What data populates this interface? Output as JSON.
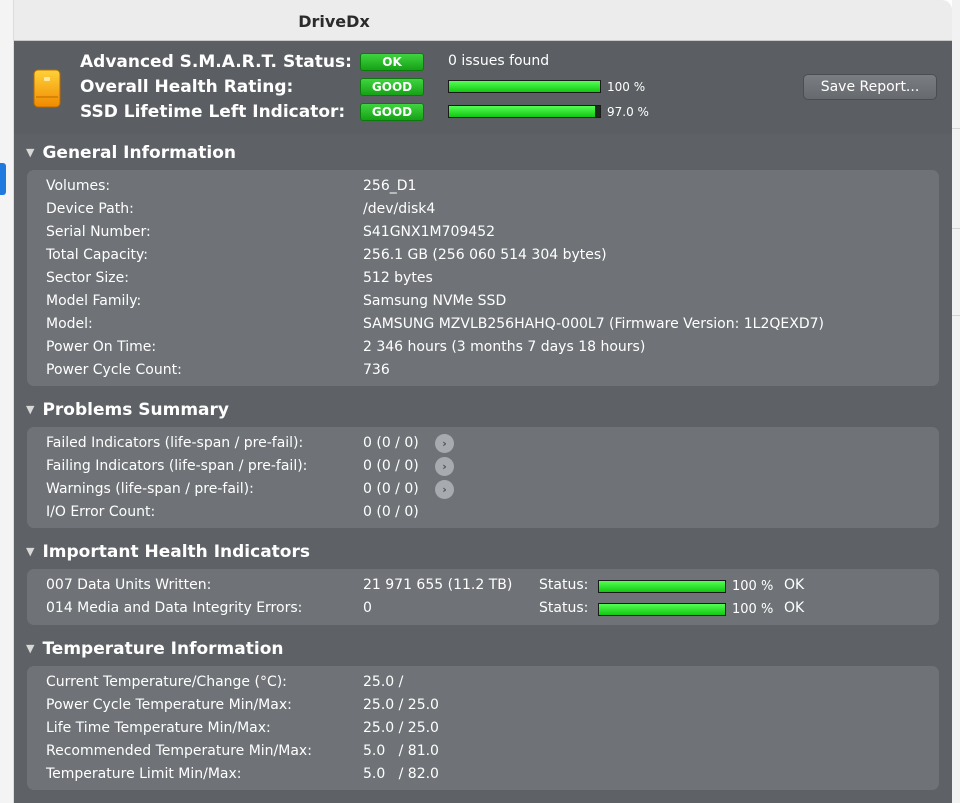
{
  "window": {
    "title": "DriveDx"
  },
  "top": {
    "smart_label": "Advanced S.M.A.R.T. Status:",
    "smart_badge": "OK",
    "smart_issues": "0 issues found",
    "health_label": "Overall Health Rating:",
    "health_badge": "GOOD",
    "health_percent_text": "100 %",
    "health_fraction": 1.0,
    "ssd_label": "SSD Lifetime Left Indicator:",
    "ssd_badge": "GOOD",
    "ssd_percent_text": "97.0 %",
    "ssd_fraction": 0.97,
    "save_button": "Save Report...",
    "badge_color": "#1fb31f",
    "bar_color": "#22dd22"
  },
  "general": {
    "heading": "General Information",
    "rows": [
      {
        "key": "Volumes:",
        "value": "256_D1"
      },
      {
        "key": "Device Path:",
        "value": "/dev/disk4"
      },
      {
        "key": "Serial Number:",
        "value": "S41GNX1M709452"
      },
      {
        "key": "Total Capacity:",
        "value": "256.1 GB (256 060 514 304 bytes)"
      },
      {
        "key": "Sector Size:",
        "value": "512 bytes"
      },
      {
        "key": "Model Family:",
        "value": "Samsung NVMe SSD"
      },
      {
        "key": "Model:",
        "value": "SAMSUNG MZVLB256HAHQ-000L7  (Firmware Version: 1L2QEXD7)"
      },
      {
        "key": "Power On Time:",
        "value": "2 346 hours (3 months 7 days 18 hours)"
      },
      {
        "key": "Power Cycle Count:",
        "value": "736"
      }
    ]
  },
  "problems": {
    "heading": "Problems Summary",
    "rows": [
      {
        "key": "Failed Indicators (life-span / pre-fail):",
        "value": "0 (0 / 0)"
      },
      {
        "key": "Failing Indicators (life-span / pre-fail):",
        "value": "0 (0 / 0)"
      },
      {
        "key": "Warnings (life-span / pre-fail):",
        "value": "0 (0 / 0)"
      },
      {
        "key": "I/O Error Count:",
        "value": "0 (0 / 0)"
      }
    ]
  },
  "health": {
    "heading": "Important Health Indicators",
    "rows": [
      {
        "key": "007  Data Units Written:",
        "value": "21 971 655 (11.2 TB)",
        "status_label": "Status:",
        "percent_text": "100 %",
        "fraction": 1.0,
        "state": "OK"
      },
      {
        "key": "014  Media and Data Integrity Errors:",
        "value": "0",
        "status_label": "Status:",
        "percent_text": "100 %",
        "fraction": 1.0,
        "state": "OK"
      }
    ]
  },
  "temperature": {
    "heading": "Temperature Information",
    "rows": [
      {
        "key": "Current Temperature/Change (°C):",
        "value": "25.0 /"
      },
      {
        "key": "Power Cycle Temperature Min/Max:",
        "value": "25.0 / 25.0"
      },
      {
        "key": "Life Time Temperature Min/Max:",
        "value": "25.0 / 25.0"
      },
      {
        "key": "Recommended Temperature Min/Max:",
        "value": "5.0   / 81.0"
      },
      {
        "key": "Temperature Limit Min/Max:",
        "value": "5.0   / 82.0"
      }
    ]
  }
}
